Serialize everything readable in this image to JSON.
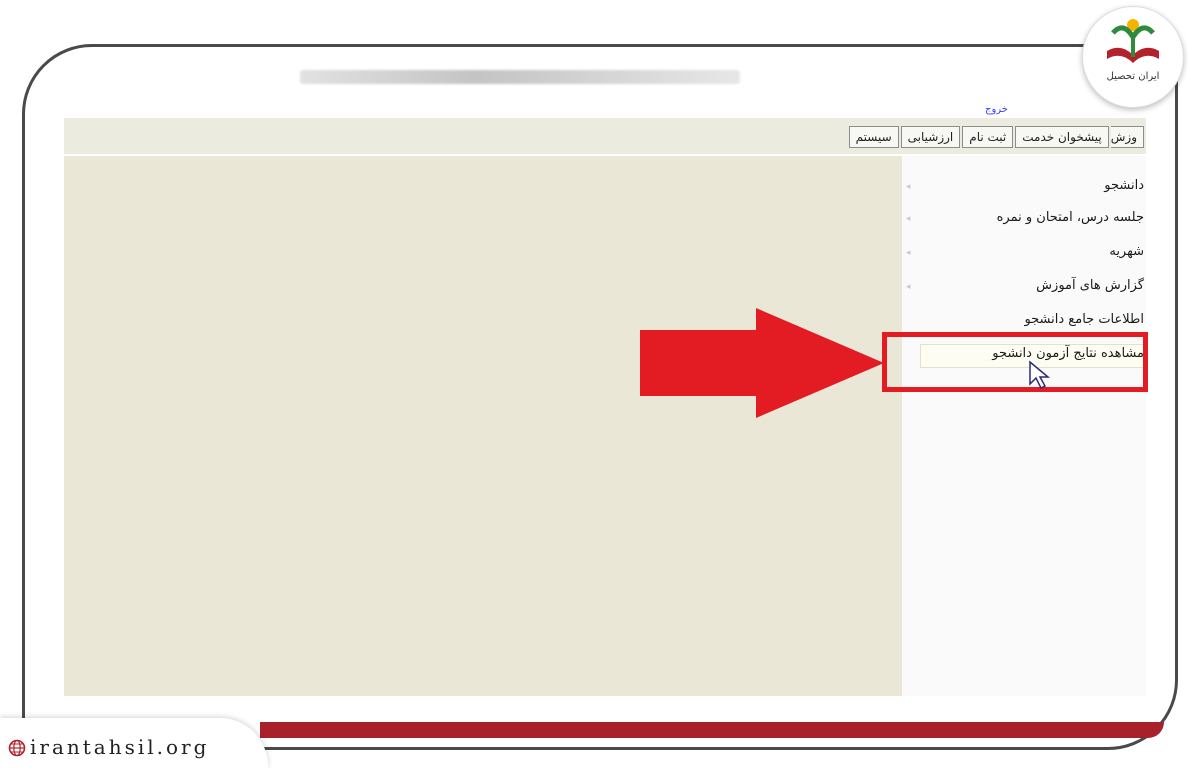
{
  "header": {
    "logout_label": "خروج"
  },
  "tabs": [
    {
      "label": "وزش"
    },
    {
      "label": "پیشخوان خدمت"
    },
    {
      "label": "ثبت نام"
    },
    {
      "label": "ارزشیابی"
    },
    {
      "label": "سیستم"
    }
  ],
  "sidebar": {
    "items": [
      {
        "label": "دانشجو"
      },
      {
        "label": "جلسه درس، امتحان و نمره"
      },
      {
        "label": "شهریه"
      },
      {
        "label": "گزارش های آموزش"
      },
      {
        "label": "اطلاعات جامع دانشجو"
      },
      {
        "label": "مشاهده نتایج آزمون دانشجو"
      }
    ]
  },
  "logo": {
    "text": "ایران تحصیل"
  },
  "watermark": {
    "text": "irantahsil.org"
  },
  "colors": {
    "accent_red": "#e31b23",
    "maroon": "#a8202a",
    "content_bg": "#ebe7d6",
    "tabbar_bg": "#ecebe0"
  }
}
